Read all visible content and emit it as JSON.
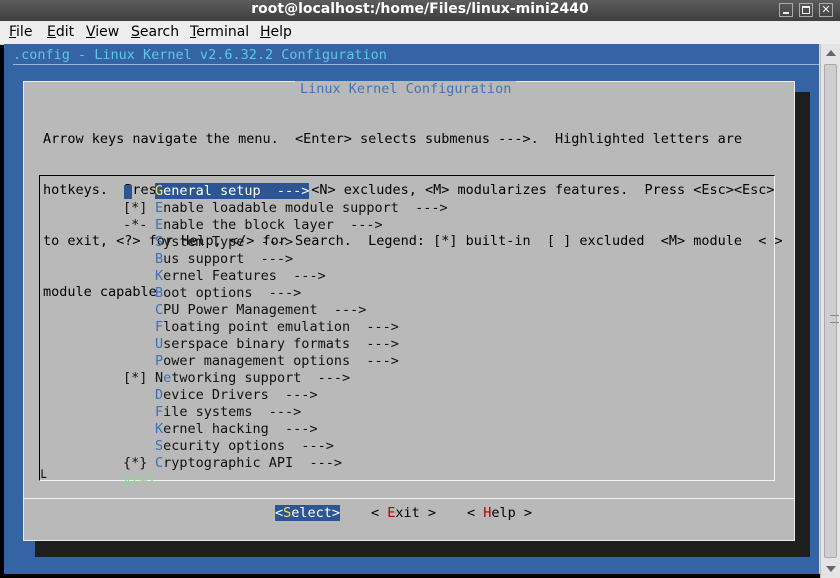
{
  "window": {
    "title": "root@localhost:/home/Files/linux-mini2440",
    "close_glyph": "✕"
  },
  "menubar": {
    "items": [
      {
        "label": "File",
        "hot": "F",
        "rest": "ile"
      },
      {
        "label": "Edit",
        "hot": "E",
        "rest": "dit"
      },
      {
        "label": "View",
        "hot": "V",
        "rest": "iew"
      },
      {
        "label": "Search",
        "hot": "S",
        "rest": "earch"
      },
      {
        "label": "Terminal",
        "hot": "T",
        "rest": "erminal"
      },
      {
        "label": "Help",
        "hot": "H",
        "rest": "elp"
      }
    ]
  },
  "terminal": {
    "header": ".config - Linux Kernel v2.6.32.2 Configuration",
    "dialog_title": "Linux Kernel Configuration",
    "help_lines": [
      "Arrow keys navigate the menu.  <Enter> selects submenus --->.  Highlighted letters are",
      "hotkeys.  Pressing <Y> includes, <N> excludes, <M> modularizes features.  Press <Esc><Esc>",
      "to exit, <?> for Help, </> for Search.  Legend: [*] built-in  [ ] excluded  <M> module  < >",
      "module capable"
    ],
    "items": [
      {
        "prefix": "",
        "hot": "G",
        "rest": "eneral setup  --->",
        "selected": true
      },
      {
        "prefix": "[*]",
        "hot": "E",
        "rest": "nable loadable module support  --->"
      },
      {
        "prefix": "-*-",
        "hot": "E",
        "rest": "nable the block layer  --->"
      },
      {
        "prefix": "",
        "hot": "S",
        "rest": "ystem Type  --->"
      },
      {
        "prefix": "",
        "hot": "B",
        "rest": "us support  --->"
      },
      {
        "prefix": "",
        "hot": "K",
        "rest": "ernel Features  --->"
      },
      {
        "prefix": "",
        "hot": "B",
        "rest": "oot options  --->"
      },
      {
        "prefix": "",
        "hot": "C",
        "rest": "PU Power Management  --->"
      },
      {
        "prefix": "",
        "hot": "F",
        "rest": "loating point emulation  --->"
      },
      {
        "prefix": "",
        "hot": "U",
        "rest": "serspace binary formats  --->"
      },
      {
        "prefix": "",
        "hot": "P",
        "rest": "ower management options  --->"
      },
      {
        "prefix": "[*]",
        "hot": "N",
        "pre": "",
        "rest": "etworking support  --->",
        "hot_index": 1
      },
      {
        "prefix": "",
        "hot": "D",
        "rest": "evice Drivers  --->"
      },
      {
        "prefix": "",
        "hot": "F",
        "rest": "ile systems  --->"
      },
      {
        "prefix": "",
        "hot": "K",
        "rest": "ernel hacking  --->"
      },
      {
        "prefix": "",
        "hot": "S",
        "rest": "ecurity options  --->"
      },
      {
        "prefix": "{*}",
        "hot": "C",
        "rest": "ryptographic API  --->"
      }
    ],
    "more_indicator": "v(+)",
    "buttons": {
      "select": {
        "open": "<",
        "hot": "S",
        "rest": "elect>"
      },
      "exit": {
        "open": "< ",
        "hot": "E",
        "rest": "xit >"
      },
      "help": {
        "open": "< ",
        "hot": "H",
        "rest": "elp >"
      }
    }
  },
  "colors": {
    "terminal_bg": "#3464a4",
    "dialog_bg": "#b9b9b9",
    "selection": "#2b5693",
    "hotkey": "#3f6fb5",
    "header_text": "#5ec8e6"
  }
}
